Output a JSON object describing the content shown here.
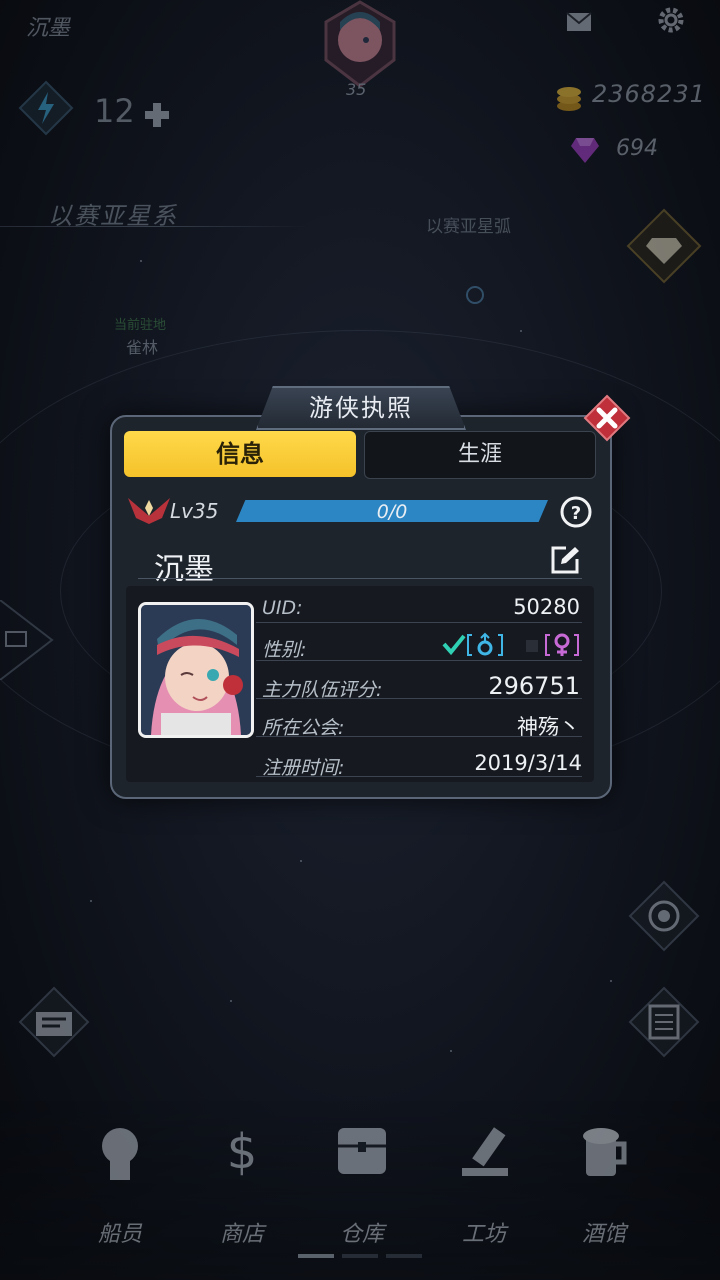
{
  "top": {
    "player_name": "沉墨",
    "avatar_level": "35",
    "energy": "12",
    "gold": "2368231",
    "gems": "694"
  },
  "map": {
    "system_title": "以赛亚星系",
    "arc_label": "以赛亚星弧",
    "station_label": "当前驻地",
    "station_name": "雀林"
  },
  "modal": {
    "title": "游侠执照",
    "tabs": [
      {
        "label": "信息"
      },
      {
        "label": "生涯"
      }
    ],
    "level": "Lv35",
    "xp": "0/0",
    "xp_fraction": 1.0,
    "name": "沉墨",
    "info": {
      "uid_label": "UID:",
      "uid": "50280",
      "gender_label": "性别:",
      "score_label": "主力队伍评分:",
      "score": "296751",
      "guild_label": "所在公会:",
      "guild": "神殇丶",
      "register_label": "注册时间:",
      "register_date": "2019/3/14"
    }
  },
  "bottom_nav": {
    "items": [
      {
        "label": "船员",
        "icon": "crew-icon"
      },
      {
        "label": "商店",
        "icon": "shop-icon"
      },
      {
        "label": "仓库",
        "icon": "warehouse-icon"
      },
      {
        "label": "工坊",
        "icon": "workshop-icon"
      },
      {
        "label": "酒馆",
        "icon": "tavern-icon"
      }
    ]
  },
  "colors": {
    "accent_yellow": "#f5c22a",
    "xp_blue": "#2c86c4",
    "close_red": "#c0303a",
    "male_cyan": "#3fb6e6",
    "female_pink": "#c86ad6"
  }
}
